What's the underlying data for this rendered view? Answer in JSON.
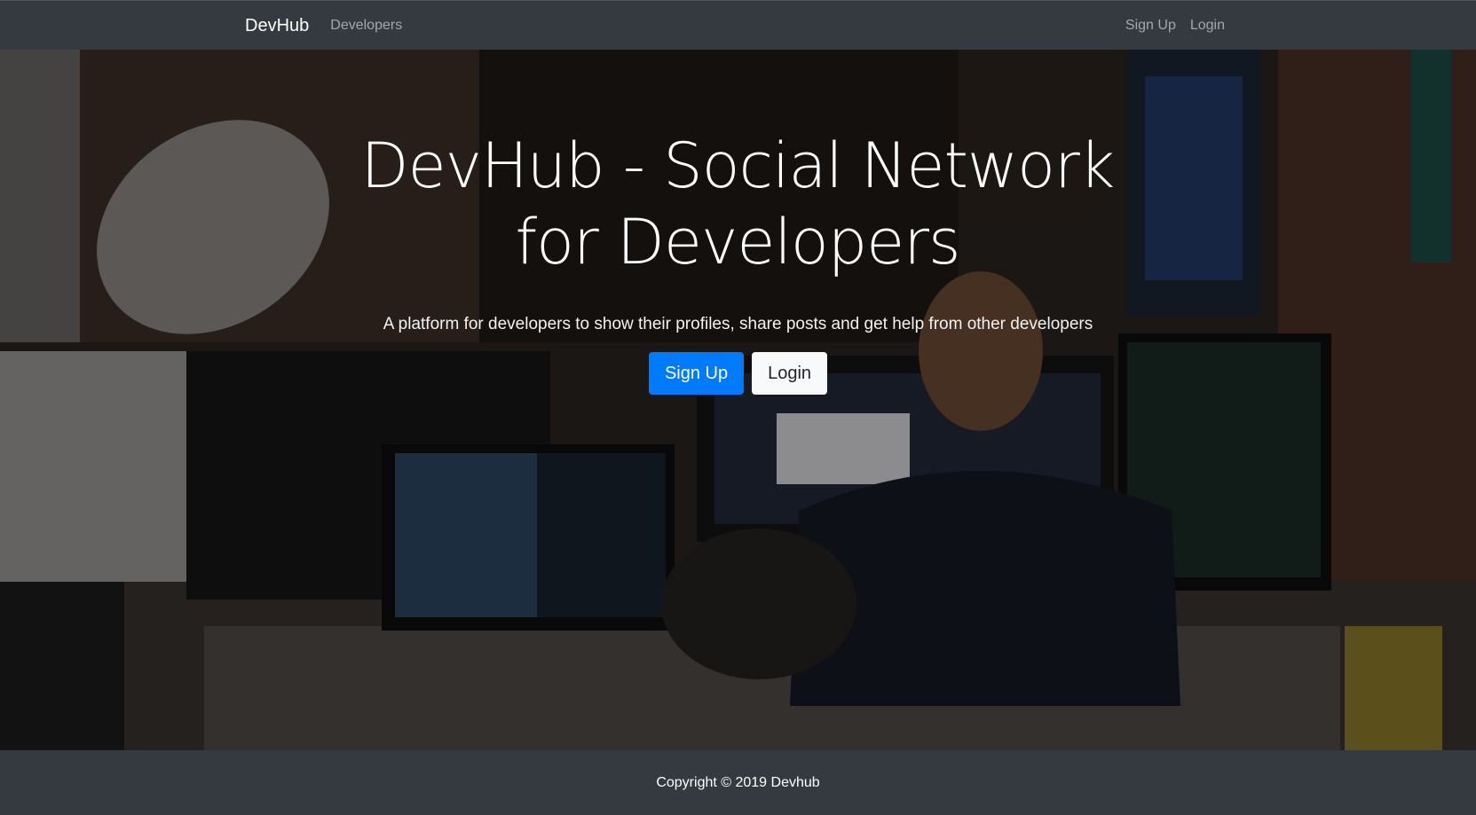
{
  "navbar": {
    "brand": "DevHub",
    "links_left": [
      "Developers"
    ],
    "links_right": [
      "Sign Up",
      "Login"
    ]
  },
  "hero": {
    "title": "DevHub - Social Network for Developers",
    "lead": "A platform for developers to show their profiles, share posts and get help from other developers",
    "primary_button": "Sign Up",
    "secondary_button": "Login",
    "background_image": "office-developers-photo"
  },
  "footer": {
    "text": "Copyright © 2019 Devhub"
  },
  "colors": {
    "navbar_bg": "#343a40",
    "primary": "#007bff",
    "light": "#f8f9fa"
  }
}
